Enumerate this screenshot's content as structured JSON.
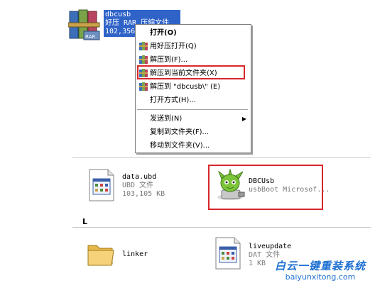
{
  "rar_file": {
    "name": "dbcusb",
    "type": "好压 RAR 压缩文件",
    "size": "102,356"
  },
  "context_menu": {
    "items": [
      {
        "label": "打开(O)",
        "bold": true,
        "icon": ""
      },
      {
        "label": "用好压打开(Q)",
        "icon": "haozip-icon"
      },
      {
        "label": "解压到(F)...",
        "icon": "haozip-icon"
      },
      {
        "label": "解压到当前文件夹(X)",
        "icon": "haozip-icon"
      },
      {
        "label": "解压到 \"dbcusb\\\" (E)",
        "icon": "haozip-icon"
      },
      {
        "label": "打开方式(H)...",
        "icon": ""
      },
      {
        "label": "发送到(N)",
        "icon": "",
        "submenu": true
      },
      {
        "label": "复制到文件夹(F)...",
        "icon": ""
      },
      {
        "label": "移动到文件夹(V)...",
        "icon": ""
      }
    ]
  },
  "files": {
    "data": {
      "name": "data.ubd",
      "type": "UBD 文件",
      "size": "103,105 KB"
    },
    "dbcusb": {
      "name": "DBCUsb",
      "desc": "usbBoot Microsof..."
    },
    "group_letter": "L",
    "linker": {
      "name": "linker"
    },
    "liveupdate": {
      "name": "liveupdate",
      "type": "DAT 文件",
      "size": "1 KB"
    }
  },
  "watermark": {
    "line1": "白云一键重装系统",
    "line2": "baiyunxitong.com"
  },
  "colors": {
    "selection": "#2f63c8",
    "highlight_box": "#d9262b",
    "watermark": "#1c6fd1"
  }
}
